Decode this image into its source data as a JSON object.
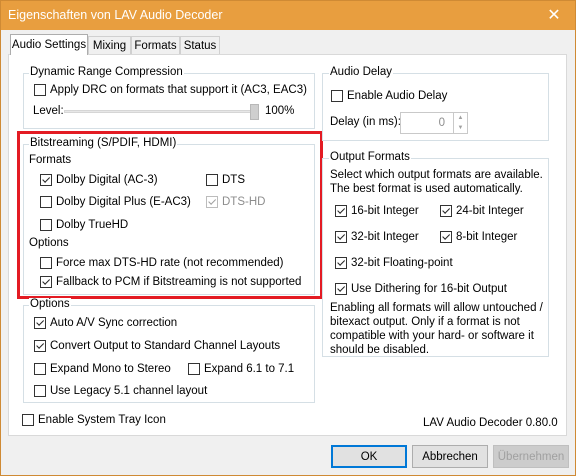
{
  "window": {
    "title": "Eigenschaften von LAV Audio Decoder",
    "close_glyph": "✕"
  },
  "tabs": [
    {
      "label": "Audio Settings",
      "active": true
    },
    {
      "label": "Mixing",
      "active": false
    },
    {
      "label": "Formats",
      "active": false
    },
    {
      "label": "Status",
      "active": false
    }
  ],
  "drc": {
    "legend": "Dynamic Range Compression",
    "apply_label": "Apply DRC on formats that support it (AC3, EAC3)",
    "apply_checked": false,
    "level_label": "Level:",
    "level_value": "100%"
  },
  "bitstreaming": {
    "legend": "Bitstreaming (S/PDIF, HDMI)",
    "formats_label": "Formats",
    "formats": [
      {
        "label": "Dolby Digital (AC-3)",
        "checked": true,
        "enabled": true
      },
      {
        "label": "DTS",
        "checked": false,
        "enabled": true
      },
      {
        "label": "Dolby Digital Plus (E-AC3)",
        "checked": false,
        "enabled": true
      },
      {
        "label": "DTS-HD",
        "checked": true,
        "enabled": false
      },
      {
        "label": "Dolby TrueHD",
        "checked": false,
        "enabled": true
      }
    ],
    "options_label": "Options",
    "options": [
      {
        "label": "Force max DTS-HD rate (not recommended)",
        "checked": false
      },
      {
        "label": "Fallback to PCM if Bitstreaming is not supported",
        "checked": true
      }
    ]
  },
  "options": {
    "legend": "Options",
    "items": [
      {
        "label": "Auto A/V Sync correction",
        "checked": true
      },
      {
        "label": "Convert Output to Standard Channel Layouts",
        "checked": true
      },
      {
        "label": "Expand Mono to Stereo",
        "checked": false
      },
      {
        "label": "Expand 6.1 to 7.1",
        "checked": false
      },
      {
        "label": "Use Legacy 5.1 channel layout",
        "checked": false
      }
    ]
  },
  "tray": {
    "label": "Enable System Tray Icon",
    "checked": false
  },
  "audio_delay": {
    "legend": "Audio Delay",
    "enable_label": "Enable Audio Delay",
    "enable_checked": false,
    "delay_label": "Delay (in ms):",
    "delay_value": "0"
  },
  "output_formats": {
    "legend": "Output Formats",
    "description": [
      "Select which output formats are available.",
      "The best format is used automatically."
    ],
    "formats": [
      {
        "label": "16-bit Integer",
        "checked": true
      },
      {
        "label": "24-bit Integer",
        "checked": true
      },
      {
        "label": "32-bit Integer",
        "checked": true
      },
      {
        "label": "8-bit Integer",
        "checked": true
      },
      {
        "label": "32-bit Floating-point",
        "checked": true
      }
    ],
    "dither_label": "Use Dithering for 16-bit Output",
    "dither_checked": true,
    "note": [
      "Enabling all formats will allow untouched /",
      "bitexact output. Only if a format is not",
      "compatible with your hard- or software it",
      "should be disabled."
    ]
  },
  "version_text": "LAV Audio Decoder 0.80.0",
  "buttons": {
    "ok": "OK",
    "cancel": "Abbrechen",
    "apply": "Übernehmen"
  },
  "colors": {
    "titlebar": "#e89e3f",
    "highlight": "#e31b23",
    "default_button": "#0078d7"
  }
}
